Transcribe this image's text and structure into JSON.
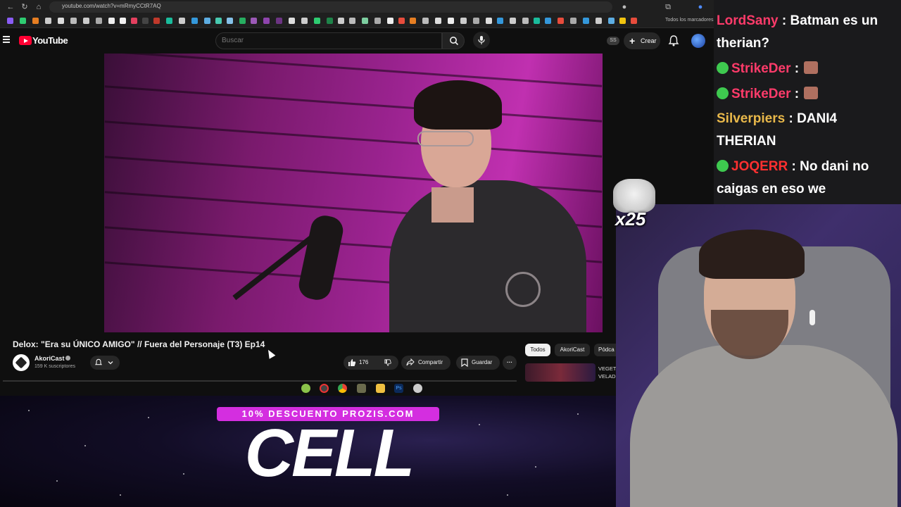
{
  "browser": {
    "url": "youtube.com/watch?v=mRmyCCtR7AQ",
    "bookmarks_folder": "Todos los marcadores"
  },
  "youtube": {
    "logo_text": "YouTube",
    "search_placeholder": "Buscar",
    "ss_badge": "SS",
    "create_label": "Crear",
    "video": {
      "title": "Delox: \"Era su ÚNICO AMIGO\" // Fuera del Personaje (T3) Ep14",
      "channel": "AkoriCast",
      "subscribers": "159 K suscriptores",
      "likes": "176",
      "share_label": "Compartir",
      "save_label": "Guardar",
      "more_label": "···"
    },
    "chips": [
      "Todos",
      "AkoriCast",
      "Pódca"
    ],
    "recommended": {
      "title": "VEGET\nVELAD"
    }
  },
  "overlay": {
    "promo_banner": "10% DESCUENTO PROZIS.COM",
    "promo_product": "CELL",
    "cat_emote_count": "x25"
  },
  "chat": {
    "messages": [
      {
        "user": "LordSany",
        "text": "Batman es un therian?",
        "color": "#ff3b6a",
        "badge": false,
        "emote": false
      },
      {
        "user": "StrikeDer",
        "text": "",
        "color": "#ff3b6a",
        "badge": true,
        "emote": true
      },
      {
        "user": "StrikeDer",
        "text": "",
        "color": "#ff3b6a",
        "badge": true,
        "emote": true
      },
      {
        "user": "Silverpiers",
        "text": "DANI4 THERIAN",
        "color": "#e8b84a",
        "badge": false,
        "emote": false
      },
      {
        "user": "JOQERR",
        "text": "No dani no caigas en eso we",
        "color": "#ff3030",
        "badge": true,
        "emote": false
      }
    ]
  }
}
